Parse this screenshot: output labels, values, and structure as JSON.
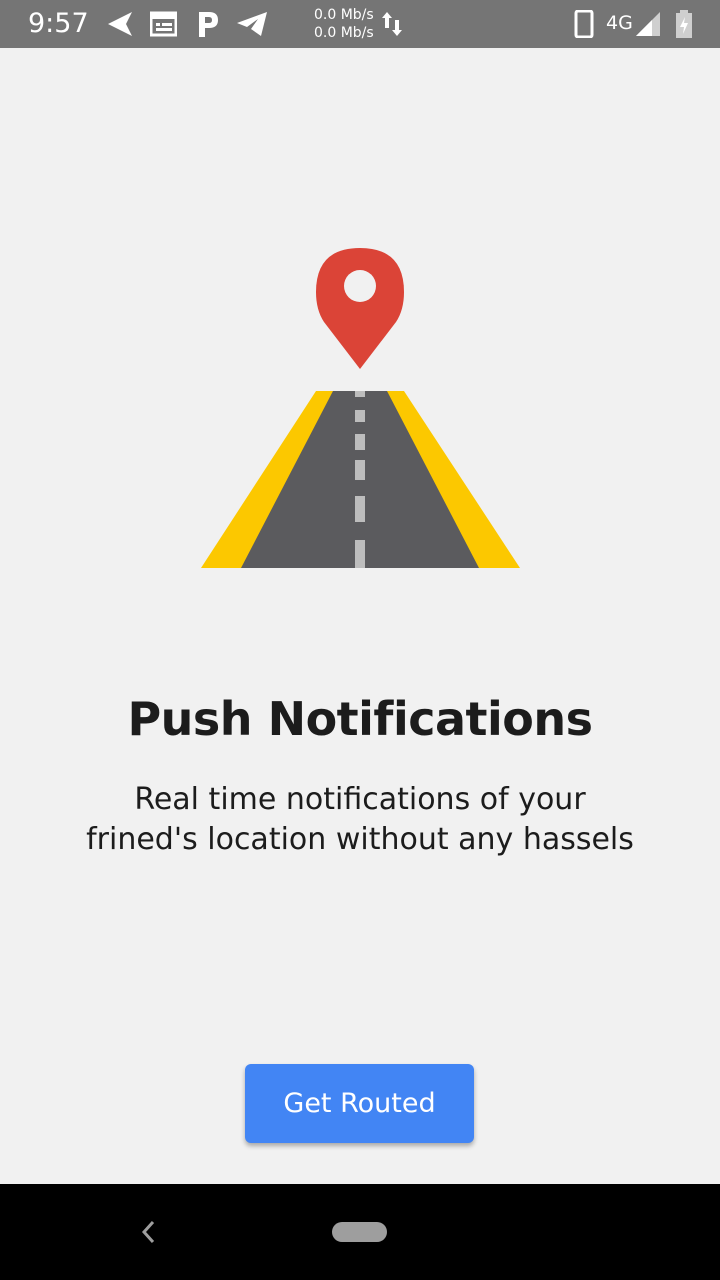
{
  "status_bar": {
    "time": "9:57",
    "speed_up": "0.0 Mb/s",
    "speed_down": "0.0 Mb/s",
    "network": "4G",
    "icons": [
      "navigation-icon",
      "calendar-icon",
      "p-app-icon",
      "telegram-icon",
      "data-transfer-icon",
      "phone-icon",
      "signal-icon",
      "battery-charging-icon"
    ]
  },
  "onboarding": {
    "title": "Push Notifications",
    "description_line1": "Real time notifications of your",
    "description_line2": "frined's location without any hassels",
    "button_label": "Get Routed"
  },
  "colors": {
    "button": "#4285f4",
    "pin": "#db4437",
    "road": "#5b5b5e",
    "road_edge": "#fcc800"
  },
  "nav_bar": {
    "icons": [
      "back-icon",
      "home-pill-icon"
    ]
  }
}
